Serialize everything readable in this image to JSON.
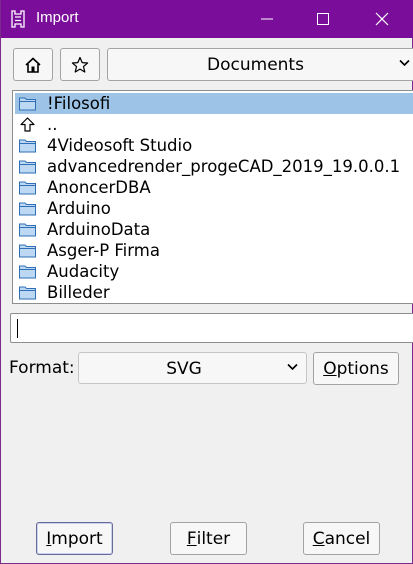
{
  "window": {
    "title": "Import",
    "titlebar_color": "#7a0e9b"
  },
  "toolbar": {
    "home_icon": "home-icon",
    "favorite_icon": "star-icon",
    "folder": "Documents"
  },
  "files": [
    {
      "name": "!Filosofi",
      "icon": "folder-icon",
      "selected": true
    },
    {
      "name": "..",
      "icon": "up-arrow-icon",
      "selected": false
    },
    {
      "name": "4Videosoft Studio",
      "icon": "folder-icon",
      "selected": false
    },
    {
      "name": "advancedrender_progeCAD_2019_19.0.0.1",
      "icon": "folder-icon",
      "selected": false
    },
    {
      "name": "AnoncerDBA",
      "icon": "folder-icon",
      "selected": false
    },
    {
      "name": "Arduino",
      "icon": "folder-icon",
      "selected": false
    },
    {
      "name": "ArduinoData",
      "icon": "folder-icon",
      "selected": false
    },
    {
      "name": "Asger-P Firma",
      "icon": "folder-icon",
      "selected": false
    },
    {
      "name": "Audacity",
      "icon": "folder-icon",
      "selected": false
    },
    {
      "name": "Billeder",
      "icon": "folder-icon",
      "selected": false
    }
  ],
  "filename": {
    "value": ""
  },
  "format": {
    "label": "Format:",
    "selected": "SVG",
    "options_button": {
      "mnemonic": "O",
      "rest": "ptions"
    }
  },
  "buttons": {
    "import": {
      "mnemonic": "I",
      "rest": "mport"
    },
    "filter": {
      "mnemonic": "F",
      "rest": "ilter"
    },
    "cancel": {
      "mnemonic": "C",
      "rest": "ancel"
    }
  },
  "colors": {
    "selection": "#9dc3e6",
    "folder_fill": "#bcd8f2",
    "folder_stroke": "#2f6fb6"
  }
}
